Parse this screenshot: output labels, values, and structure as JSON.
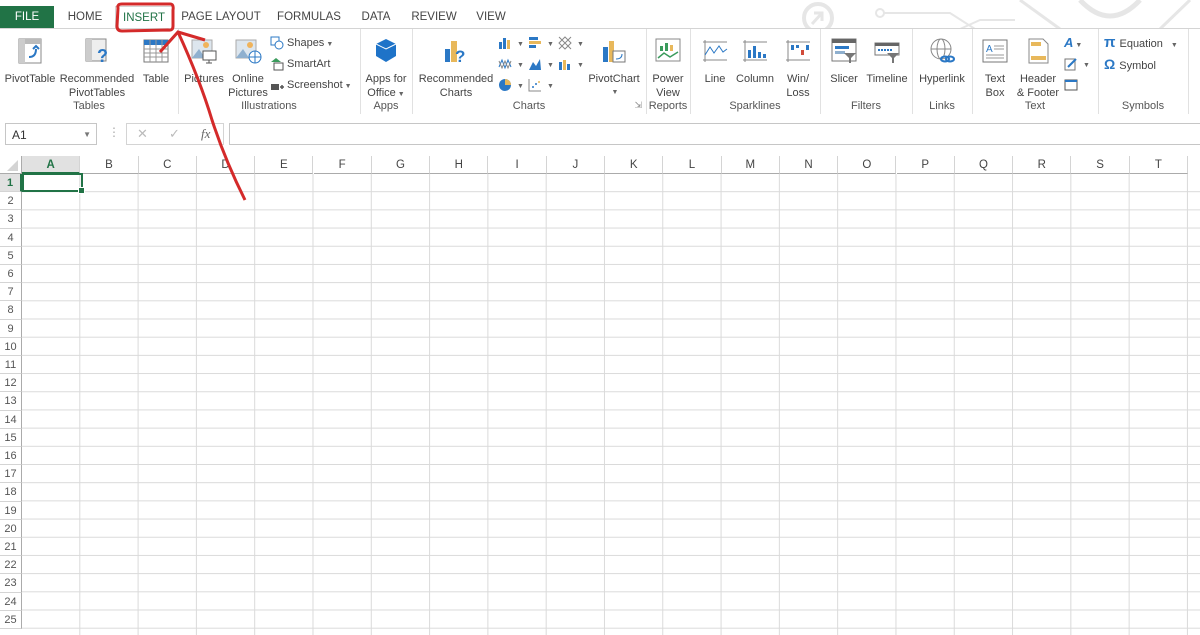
{
  "tabs": [
    {
      "label": "FILE"
    },
    {
      "label": "HOME"
    },
    {
      "label": "INSERT",
      "active": true
    },
    {
      "label": "PAGE LAYOUT"
    },
    {
      "label": "FORMULAS"
    },
    {
      "label": "DATA"
    },
    {
      "label": "REVIEW"
    },
    {
      "label": "VIEW"
    }
  ],
  "ribbon": {
    "tables": {
      "label": "Tables",
      "pivottable": "PivotTable",
      "recommended_line1": "Recommended",
      "recommended_line2": "PivotTables",
      "table": "Table"
    },
    "illustrations": {
      "label": "Illustrations",
      "pictures": "Pictures",
      "online_line1": "Online",
      "online_line2": "Pictures",
      "shapes": "Shapes",
      "smartart": "SmartArt",
      "screenshot": "Screenshot"
    },
    "apps": {
      "label": "Apps",
      "line1": "Apps for",
      "line2": "Office"
    },
    "charts": {
      "label": "Charts",
      "recommended_line1": "Recommended",
      "recommended_line2": "Charts",
      "pivotchart": "PivotChart"
    },
    "reports": {
      "label": "Reports",
      "line1": "Power",
      "line2": "View"
    },
    "sparklines": {
      "label": "Sparklines",
      "line": "Line",
      "column": "Column",
      "winloss_line1": "Win/",
      "winloss_line2": "Loss"
    },
    "filters": {
      "label": "Filters",
      "slicer": "Slicer",
      "timeline": "Timeline"
    },
    "links": {
      "label": "Links",
      "hyperlink": "Hyperlink"
    },
    "text": {
      "label": "Text",
      "textbox_line1": "Text",
      "textbox_line2": "Box",
      "header_line1": "Header",
      "header_line2": "& Footer"
    },
    "symbols": {
      "label": "Symbols",
      "equation": "Equation",
      "symbol": "Symbol"
    }
  },
  "formula_bar": {
    "name_box": "A1",
    "cancel": "✕",
    "enter": "✓",
    "fx": "fx",
    "value": ""
  },
  "columns": [
    "A",
    "B",
    "C",
    "D",
    "E",
    "F",
    "G",
    "H",
    "I",
    "J",
    "K",
    "L",
    "M",
    "N",
    "O",
    "P",
    "Q",
    "R",
    "S",
    "T"
  ],
  "rows": [
    "1",
    "2",
    "3",
    "4",
    "5",
    "6",
    "7",
    "8",
    "9",
    "10",
    "11",
    "12",
    "13",
    "14",
    "15",
    "16",
    "17",
    "18",
    "19",
    "20",
    "21",
    "22",
    "23",
    "24",
    "25"
  ],
  "active_cell": "A1",
  "colors": {
    "accent": "#217346",
    "annotation": "#d42a2a"
  }
}
